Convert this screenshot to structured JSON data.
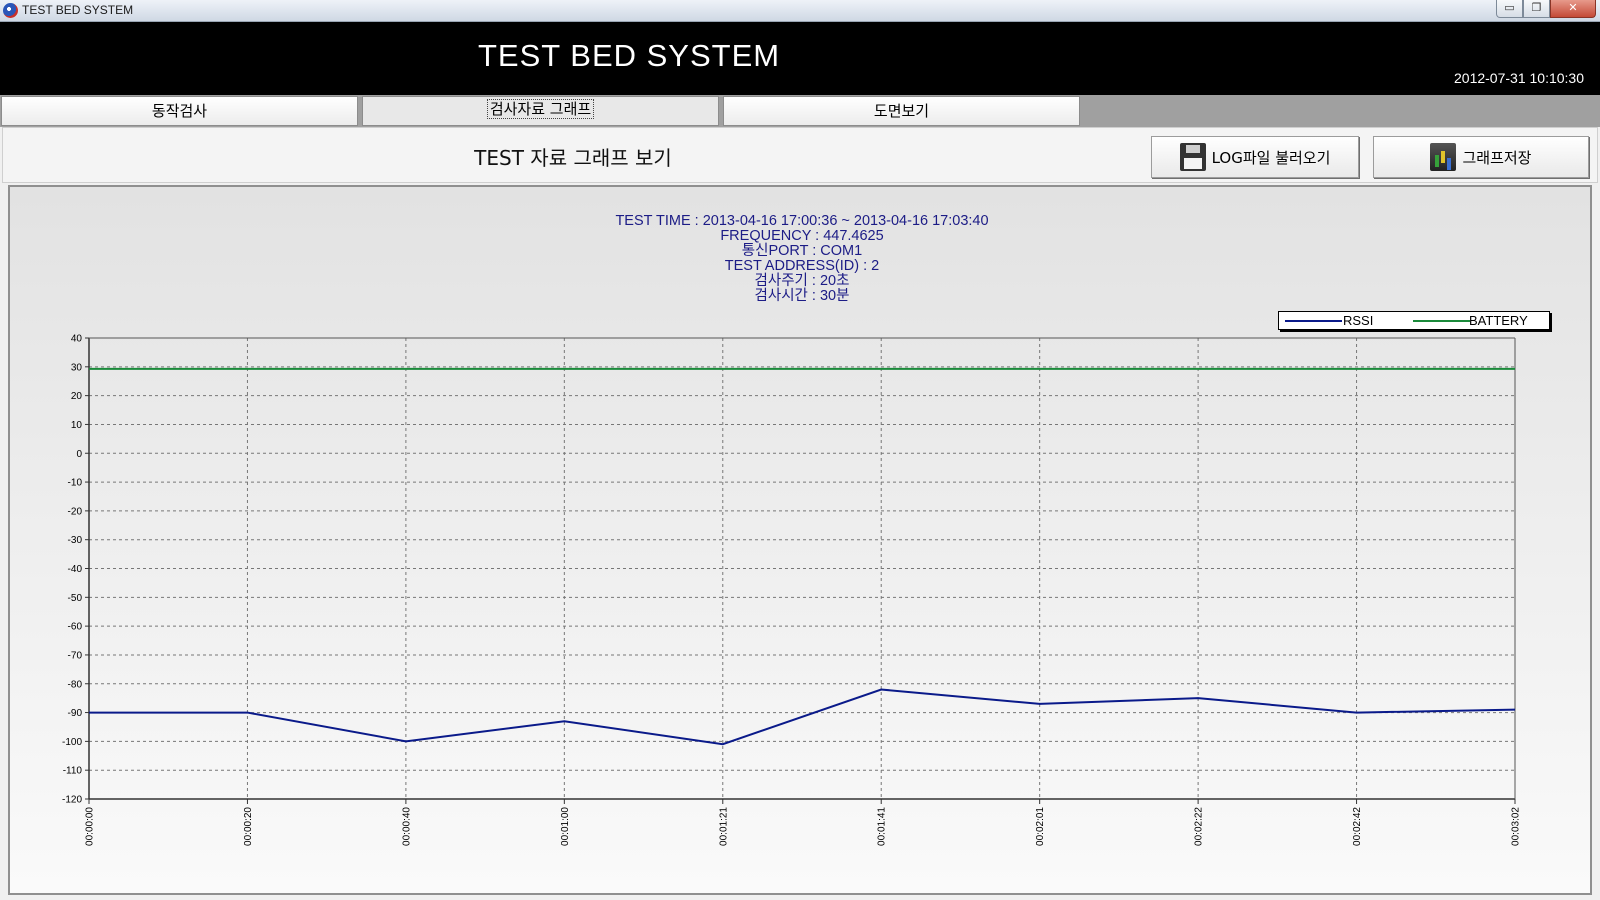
{
  "window": {
    "title": "TEST BED SYSTEM",
    "controls": [
      "▭",
      "❐",
      "✕"
    ]
  },
  "header": {
    "title": "TEST BED SYSTEM",
    "datetime": "2012-07-31 10:10:30"
  },
  "tabs": [
    {
      "label": "동작검사"
    },
    {
      "label": "검사자료 그래프",
      "active": true
    },
    {
      "label": "도면보기"
    }
  ],
  "toolbar": {
    "title": "TEST 자료 그래프 보기",
    "load_button": "LOG파일 불러오기",
    "save_button": "그래프저장"
  },
  "info": {
    "test_time": "TEST TIME : 2013-04-16 17:00:36 ~ 2013-04-16 17:03:40",
    "frequency": "FREQUENCY : 447.4625",
    "port": "통신PORT : COM1",
    "address": "TEST ADDRESS(ID) : 2",
    "cycle": "검사주기 : 20초",
    "duration": "검사시간 : 30분"
  },
  "chart_data": {
    "type": "line",
    "x": [
      "00:00:00",
      "00:00:20",
      "00:00:40",
      "00:01:00",
      "00:01:21",
      "00:01:41",
      "00:02:01",
      "00:02:22",
      "00:02:42",
      "00:03:02"
    ],
    "series": [
      {
        "name": "RSSI",
        "color": "#0a1a8a",
        "values": [
          -90,
          -90,
          -100,
          -93,
          -101,
          -82,
          -87,
          -85,
          -90,
          -89
        ]
      },
      {
        "name": "BATTERY",
        "color": "#1a8a3a",
        "values": [
          29.3,
          29.3,
          29.3,
          29.3,
          29.3,
          29.3,
          29.3,
          29.3,
          29.3,
          29.3
        ]
      }
    ],
    "ylim": [
      -120,
      40
    ],
    "yticks": [
      40,
      30,
      20,
      10,
      0,
      -10,
      -20,
      -30,
      -40,
      -50,
      -60,
      -70,
      -80,
      -90,
      -100,
      -110,
      -120
    ],
    "grid": true,
    "legend": "top-right"
  }
}
